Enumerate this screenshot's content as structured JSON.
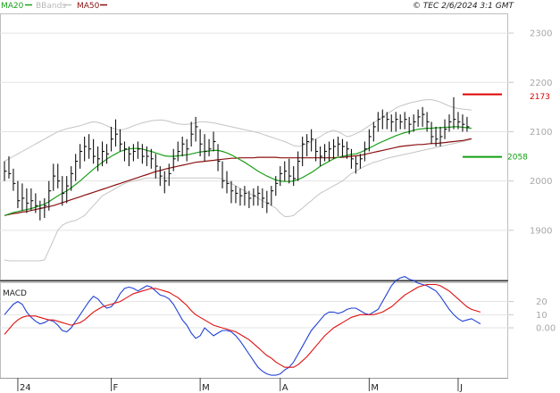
{
  "header": {
    "copyright": "© TEC 2/6/2024 3:1 GMT"
  },
  "legend": {
    "ma20": {
      "label": "MA20",
      "color": "#1aa01a"
    },
    "bbands": {
      "label": "BBands",
      "color": "#b8b8b8"
    },
    "ma50": {
      "label": "MA50",
      "color": "#8b1010"
    }
  },
  "levels": {
    "resistance": {
      "label": "2173",
      "value": 2173,
      "color": "#e00000"
    },
    "support": {
      "label": "2058",
      "value": 2058,
      "color": "#10a010"
    }
  },
  "macd_panel": {
    "title": "MACD"
  },
  "chart_data": [
    {
      "type": "ohlc",
      "ylim": [
        1800,
        2340
      ],
      "grid": true,
      "legend_position": "top-left",
      "yticks": [
        "2300",
        "2200",
        "2100",
        "2000",
        "1900"
      ],
      "ytick_values": [
        2300,
        2200,
        2100,
        2000,
        1900
      ],
      "xticks": [
        "24",
        "F",
        "M",
        "A",
        "M",
        "J"
      ],
      "xtick_bars": [
        3,
        24,
        44,
        62,
        82,
        102
      ],
      "bars": [
        {
          "h": 2040,
          "l": 2000,
          "c": 2020
        },
        {
          "h": 2050,
          "l": 2005,
          "c": 2015
        },
        {
          "h": 2025,
          "l": 1980,
          "c": 1995
        },
        {
          "h": 2000,
          "l": 1945,
          "c": 1960
        },
        {
          "h": 1995,
          "l": 1940,
          "c": 1965
        },
        {
          "h": 1985,
          "l": 1935,
          "c": 1955
        },
        {
          "h": 1985,
          "l": 1940,
          "c": 1960
        },
        {
          "h": 1975,
          "l": 1935,
          "c": 1950
        },
        {
          "h": 1960,
          "l": 1920,
          "c": 1945
        },
        {
          "h": 1965,
          "l": 1925,
          "c": 1950
        },
        {
          "h": 2000,
          "l": 1940,
          "c": 1980
        },
        {
          "h": 2035,
          "l": 1980,
          "c": 2010
        },
        {
          "h": 2035,
          "l": 1985,
          "c": 2000
        },
        {
          "h": 2010,
          "l": 1950,
          "c": 1975
        },
        {
          "h": 2010,
          "l": 1955,
          "c": 1990
        },
        {
          "h": 2030,
          "l": 1980,
          "c": 2015
        },
        {
          "h": 2055,
          "l": 2000,
          "c": 2040
        },
        {
          "h": 2075,
          "l": 2025,
          "c": 2060
        },
        {
          "h": 2090,
          "l": 2040,
          "c": 2070
        },
        {
          "h": 2095,
          "l": 2045,
          "c": 2065
        },
        {
          "h": 2085,
          "l": 2035,
          "c": 2050
        },
        {
          "h": 2070,
          "l": 2020,
          "c": 2045
        },
        {
          "h": 2080,
          "l": 2030,
          "c": 2060
        },
        {
          "h": 2075,
          "l": 2035,
          "c": 2055
        },
        {
          "h": 2110,
          "l": 2060,
          "c": 2085
        },
        {
          "h": 2125,
          "l": 2070,
          "c": 2095
        },
        {
          "h": 2105,
          "l": 2060,
          "c": 2075
        },
        {
          "h": 2080,
          "l": 2040,
          "c": 2065
        },
        {
          "h": 2070,
          "l": 2030,
          "c": 2055
        },
        {
          "h": 2075,
          "l": 2040,
          "c": 2060
        },
        {
          "h": 2080,
          "l": 2045,
          "c": 2065
        },
        {
          "h": 2075,
          "l": 2035,
          "c": 2050
        },
        {
          "h": 2070,
          "l": 2030,
          "c": 2050
        },
        {
          "h": 2065,
          "l": 2025,
          "c": 2045
        },
        {
          "h": 2055,
          "l": 2005,
          "c": 2030
        },
        {
          "h": 2030,
          "l": 1990,
          "c": 2010
        },
        {
          "h": 2020,
          "l": 1975,
          "c": 2000
        },
        {
          "h": 2035,
          "l": 1990,
          "c": 2015
        },
        {
          "h": 2065,
          "l": 2020,
          "c": 2045
        },
        {
          "h": 2080,
          "l": 2040,
          "c": 2060
        },
        {
          "h": 2090,
          "l": 2050,
          "c": 2075
        },
        {
          "h": 2085,
          "l": 2040,
          "c": 2065
        },
        {
          "h": 2120,
          "l": 2070,
          "c": 2095
        },
        {
          "h": 2130,
          "l": 2080,
          "c": 2110
        },
        {
          "h": 2105,
          "l": 2050,
          "c": 2075
        },
        {
          "h": 2095,
          "l": 2040,
          "c": 2060
        },
        {
          "h": 2085,
          "l": 2050,
          "c": 2065
        },
        {
          "h": 2100,
          "l": 2060,
          "c": 2080
        },
        {
          "h": 2075,
          "l": 2020,
          "c": 2040
        },
        {
          "h": 2040,
          "l": 1985,
          "c": 2000
        },
        {
          "h": 2020,
          "l": 1975,
          "c": 1995
        },
        {
          "h": 2000,
          "l": 1955,
          "c": 1980
        },
        {
          "h": 1990,
          "l": 1955,
          "c": 1975
        },
        {
          "h": 1985,
          "l": 1950,
          "c": 1970
        },
        {
          "h": 1990,
          "l": 1950,
          "c": 1975
        },
        {
          "h": 1980,
          "l": 1945,
          "c": 1965
        },
        {
          "h": 1985,
          "l": 1950,
          "c": 1970
        },
        {
          "h": 1990,
          "l": 1950,
          "c": 1975
        },
        {
          "h": 1985,
          "l": 1945,
          "c": 1965
        },
        {
          "h": 1980,
          "l": 1935,
          "c": 1955
        },
        {
          "h": 1990,
          "l": 1950,
          "c": 1980
        },
        {
          "h": 2010,
          "l": 1970,
          "c": 1995
        },
        {
          "h": 2030,
          "l": 1990,
          "c": 2015
        },
        {
          "h": 2040,
          "l": 2000,
          "c": 2020
        },
        {
          "h": 2045,
          "l": 1995,
          "c": 2010
        },
        {
          "h": 2030,
          "l": 1990,
          "c": 2005
        },
        {
          "h": 2060,
          "l": 2000,
          "c": 2040
        },
        {
          "h": 2090,
          "l": 2030,
          "c": 2075
        },
        {
          "h": 2095,
          "l": 2050,
          "c": 2080
        },
        {
          "h": 2105,
          "l": 2060,
          "c": 2085
        },
        {
          "h": 2085,
          "l": 2040,
          "c": 2060
        },
        {
          "h": 2070,
          "l": 2030,
          "c": 2050
        },
        {
          "h": 2075,
          "l": 2040,
          "c": 2060
        },
        {
          "h": 2080,
          "l": 2040,
          "c": 2065
        },
        {
          "h": 2085,
          "l": 2045,
          "c": 2070
        },
        {
          "h": 2090,
          "l": 2050,
          "c": 2075
        },
        {
          "h": 2085,
          "l": 2050,
          "c": 2070
        },
        {
          "h": 2080,
          "l": 2045,
          "c": 2065
        },
        {
          "h": 2065,
          "l": 2025,
          "c": 2045
        },
        {
          "h": 2050,
          "l": 2015,
          "c": 2035
        },
        {
          "h": 2055,
          "l": 2025,
          "c": 2045
        },
        {
          "h": 2080,
          "l": 2040,
          "c": 2065
        },
        {
          "h": 2105,
          "l": 2060,
          "c": 2090
        },
        {
          "h": 2120,
          "l": 2080,
          "c": 2110
        },
        {
          "h": 2140,
          "l": 2100,
          "c": 2125
        },
        {
          "h": 2145,
          "l": 2105,
          "c": 2130
        },
        {
          "h": 2140,
          "l": 2105,
          "c": 2125
        },
        {
          "h": 2135,
          "l": 2100,
          "c": 2120
        },
        {
          "h": 2140,
          "l": 2100,
          "c": 2125
        },
        {
          "h": 2135,
          "l": 2105,
          "c": 2120
        },
        {
          "h": 2140,
          "l": 2105,
          "c": 2125
        },
        {
          "h": 2130,
          "l": 2095,
          "c": 2115
        },
        {
          "h": 2135,
          "l": 2100,
          "c": 2120
        },
        {
          "h": 2145,
          "l": 2110,
          "c": 2130
        },
        {
          "h": 2150,
          "l": 2110,
          "c": 2135
        },
        {
          "h": 2140,
          "l": 2100,
          "c": 2120
        },
        {
          "h": 2120,
          "l": 2075,
          "c": 2090
        },
        {
          "h": 2110,
          "l": 2070,
          "c": 2085
        },
        {
          "h": 2110,
          "l": 2070,
          "c": 2090
        },
        {
          "h": 2125,
          "l": 2085,
          "c": 2105
        },
        {
          "h": 2135,
          "l": 2100,
          "c": 2120
        },
        {
          "h": 2170,
          "l": 2105,
          "c": 2125
        },
        {
          "h": 2140,
          "l": 2105,
          "c": 2120
        },
        {
          "h": 2135,
          "l": 2100,
          "c": 2115
        },
        {
          "h": 2130,
          "l": 2100,
          "c": 2110
        }
      ],
      "ma20": [
        1930,
        1933,
        1936,
        1938,
        1940,
        1942,
        1944,
        1947,
        1950,
        1953,
        1958,
        1964,
        1970,
        1975,
        1980,
        1986,
        1993,
        2000,
        2008,
        2016,
        2024,
        2031,
        2038,
        2044,
        2050,
        2055,
        2060,
        2063,
        2065,
        2066,
        2066,
        2065,
        2062,
        2060,
        2057,
        2054,
        2051,
        2050,
        2050,
        2051,
        2052,
        2053,
        2055,
        2057,
        2059,
        2060,
        2061,
        2062,
        2062,
        2060,
        2057,
        2053,
        2048,
        2043,
        2038,
        2032,
        2026,
        2020,
        2015,
        2010,
        2006,
        2002,
        2000,
        1999,
        1999,
        2000,
        2003,
        2007,
        2012,
        2017,
        2023,
        2030,
        2035,
        2040,
        2045,
        2048,
        2050,
        2052,
        2054,
        2055,
        2058,
        2062,
        2067,
        2071,
        2076,
        2080,
        2084,
        2088,
        2092,
        2095,
        2098,
        2100,
        2103,
        2105,
        2106,
        2107,
        2107,
        2108,
        2108,
        2109,
        2109,
        2110,
        2110,
        2109,
        2108,
        2107
      ],
      "ma50": [
        1930,
        1932,
        1934,
        1935,
        1937,
        1938,
        1940,
        1942,
        1944,
        1946,
        1948,
        1950,
        1953,
        1956,
        1959,
        1962,
        1965,
        1968,
        1971,
        1974,
        1977,
        1980,
        1983,
        1986,
        1989,
        1992,
        1995,
        1998,
        2001,
        2004,
        2007,
        2010,
        2013,
        2016,
        2019,
        2021,
        2024,
        2026,
        2028,
        2030,
        2032,
        2034,
        2036,
        2038,
        2039,
        2040,
        2041,
        2042,
        2043,
        2044,
        2045,
        2046,
        2046,
        2047,
        2047,
        2047,
        2047,
        2048,
        2048,
        2048,
        2048,
        2048,
        2047,
        2047,
        2047,
        2047,
        2047,
        2047,
        2047,
        2047,
        2047,
        2047,
        2047,
        2047,
        2047,
        2048,
        2048,
        2049,
        2050,
        2051,
        2052,
        2054,
        2056,
        2058,
        2060,
        2062,
        2064,
        2066,
        2068,
        2070,
        2071,
        2072,
        2073,
        2074,
        2074,
        2075,
        2076,
        2076,
        2077,
        2078,
        2079,
        2080,
        2081,
        2082,
        2084,
        2086
      ],
      "bb_upper": [
        2040,
        2045,
        2050,
        2055,
        2060,
        2065,
        2070,
        2075,
        2080,
        2085,
        2090,
        2095,
        2100,
        2103,
        2106,
        2108,
        2110,
        2112,
        2115,
        2118,
        2120,
        2119,
        2116,
        2112,
        2108,
        2105,
        2103,
        2105,
        2108,
        2112,
        2115,
        2118,
        2120,
        2122,
        2123,
        2124,
        2123,
        2121,
        2118,
        2116,
        2115,
        2115,
        2116,
        2118,
        2120,
        2120,
        2119,
        2118,
        2116,
        2114,
        2112,
        2110,
        2108,
        2106,
        2104,
        2102,
        2100,
        2098,
        2095,
        2092,
        2089,
        2086,
        2083,
        2080,
        2076,
        2072,
        2070,
        2072,
        2076,
        2080,
        2085,
        2090,
        2096,
        2100,
        2103,
        2100,
        2095,
        2090,
        2092,
        2096,
        2100,
        2106,
        2112,
        2118,
        2124,
        2130,
        2136,
        2142,
        2148,
        2152,
        2155,
        2158,
        2160,
        2162,
        2164,
        2165,
        2165,
        2163,
        2160,
        2156,
        2152,
        2149,
        2147,
        2146,
        2145,
        2144
      ],
      "bb_lower": [
        1840,
        1838,
        1838,
        1838,
        1838,
        1838,
        1838,
        1838,
        1838,
        1840,
        1860,
        1880,
        1900,
        1910,
        1915,
        1918,
        1920,
        1925,
        1930,
        1940,
        1950,
        1960,
        1970,
        1975,
        1980,
        1985,
        1990,
        1995,
        1998,
        2000,
        2002,
        2004,
        2006,
        2006,
        2006,
        2006,
        2006,
        2006,
        2006,
        2006,
        2006,
        2006,
        2006,
        2006,
        2006,
        2006,
        2006,
        2006,
        2006,
        2004,
        2000,
        1995,
        1990,
        1985,
        1980,
        1975,
        1970,
        1965,
        1960,
        1955,
        1950,
        1945,
        1935,
        1928,
        1928,
        1930,
        1938,
        1945,
        1953,
        1960,
        1968,
        1975,
        1980,
        1985,
        1990,
        1995,
        2000,
        2008,
        2015,
        2020,
        2025,
        2030,
        2034,
        2038,
        2040,
        2043,
        2046,
        2048,
        2050,
        2052,
        2054,
        2056,
        2058,
        2060,
        2062,
        2064,
        2066,
        2068,
        2070,
        2072,
        2074,
        2076,
        2078,
        2080,
        2082,
        2084
      ]
    },
    {
      "type": "line",
      "title": "MACD",
      "ylim": [
        -38,
        34
      ],
      "grid": true,
      "yticks": [
        "20",
        "10",
        "0.00"
      ],
      "ytick_values": [
        20,
        10,
        0
      ],
      "series": [
        {
          "role": "macd",
          "color": "#2040d8",
          "values": [
            10,
            14,
            18,
            20,
            18,
            12,
            8,
            5,
            3,
            4,
            6,
            5,
            2,
            -2,
            -3,
            0,
            5,
            10,
            15,
            20,
            24,
            22,
            18,
            15,
            16,
            20,
            26,
            30,
            31,
            30,
            28,
            30,
            32,
            31,
            28,
            25,
            24,
            22,
            18,
            12,
            6,
            2,
            -4,
            -8,
            -6,
            0,
            -3,
            -6,
            -4,
            -2,
            -2,
            -3,
            -6,
            -10,
            -15,
            -20,
            -25,
            -30,
            -33,
            -35,
            -36,
            -36,
            -35,
            -32,
            -30,
            -26,
            -20,
            -14,
            -8,
            -2,
            2,
            6,
            10,
            12,
            12,
            11,
            12,
            14,
            15,
            15,
            13,
            11,
            10,
            12,
            14,
            20,
            26,
            32,
            36,
            38,
            39,
            37,
            36,
            34,
            33,
            32,
            30,
            28,
            24,
            19,
            14,
            10,
            7,
            5,
            6,
            7,
            5,
            3
          ]
        },
        {
          "role": "signal",
          "color": "#e01010",
          "values": [
            -5,
            -1,
            3,
            6,
            8,
            9,
            9,
            9,
            8,
            7,
            6,
            6,
            5,
            4,
            3,
            2,
            3,
            4,
            6,
            9,
            12,
            14,
            16,
            17,
            18,
            19,
            20,
            22,
            24,
            26,
            27,
            28,
            29,
            30,
            30,
            29,
            28,
            27,
            25,
            23,
            20,
            17,
            13,
            10,
            8,
            6,
            4,
            2,
            1,
            0,
            -1,
            -2,
            -3,
            -5,
            -7,
            -9,
            -12,
            -15,
            -18,
            -21,
            -23,
            -26,
            -28,
            -30,
            -30,
            -30,
            -28,
            -25,
            -22,
            -18,
            -14,
            -10,
            -6,
            -3,
            0,
            2,
            4,
            6,
            8,
            9,
            10,
            10,
            10,
            10,
            11,
            12,
            14,
            16,
            19,
            22,
            25,
            27,
            29,
            31,
            32,
            33,
            33,
            33,
            32,
            30,
            28,
            25,
            22,
            19,
            16,
            14,
            13,
            12
          ]
        }
      ]
    }
  ]
}
